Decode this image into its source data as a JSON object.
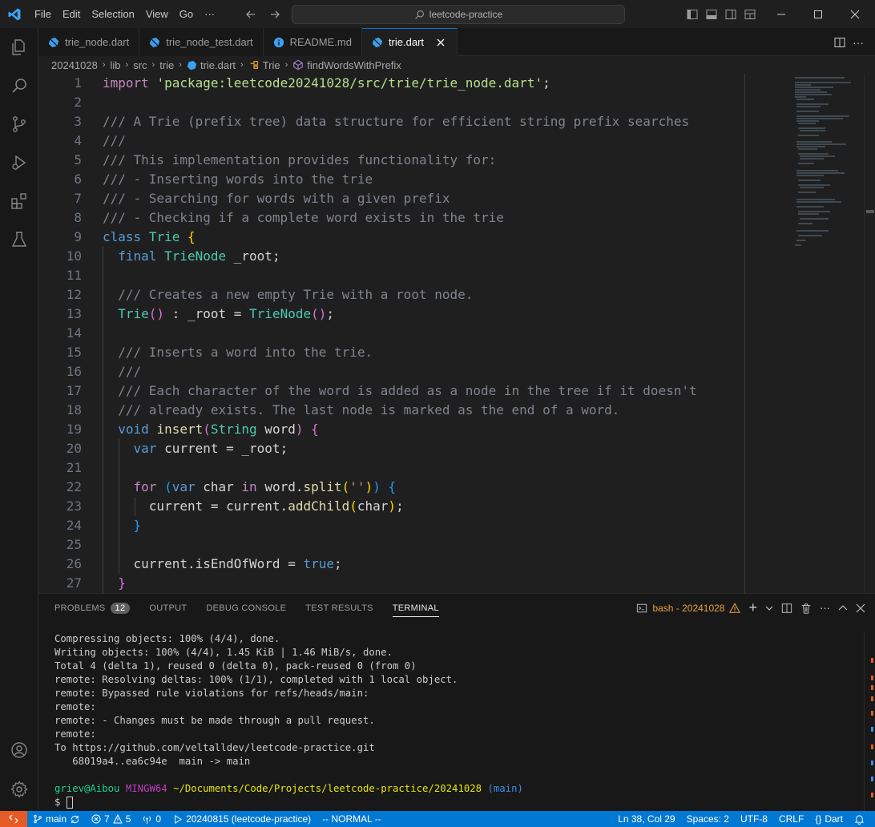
{
  "titlebar": {
    "menu": [
      "File",
      "Edit",
      "Selection",
      "View",
      "Go",
      "···"
    ],
    "search_text": "leetcode-practice"
  },
  "tabs": [
    {
      "label": "trie_node.dart",
      "icon": "dart-icon",
      "active": false
    },
    {
      "label": "trie_node_test.dart",
      "icon": "dart-icon",
      "active": false
    },
    {
      "label": "README.md",
      "icon": "info-icon",
      "active": false
    },
    {
      "label": "trie.dart",
      "icon": "dart-icon",
      "active": true
    }
  ],
  "breadcrumb": [
    "20241028",
    "lib",
    "src",
    "trie",
    "trie.dart",
    "Trie",
    "findWordsWithPrefix"
  ],
  "editor": {
    "line_numbers": [
      "1",
      "2",
      "3",
      "4",
      "5",
      "6",
      "7",
      "8",
      "9",
      "10",
      "11",
      "12",
      "13",
      "14",
      "15",
      "16",
      "17",
      "18",
      "19",
      "20",
      "21",
      "22",
      "23",
      "24",
      "25",
      "26",
      "27"
    ],
    "import_path": "'package:leetcode20241028/src/trie/trie_node.dart'",
    "comments": {
      "l3": "/// A Trie (prefix tree) data structure for efficient string prefix searches",
      "l4": "///",
      "l5": "/// This implementation provides functionality for:",
      "l6": "/// - Inserting words into the trie",
      "l7": "/// - Searching for words with a given prefix",
      "l8": "/// - Checking if a complete word exists in the trie",
      "l12": "/// Creates a new empty Trie with a root node.",
      "l15": "/// Inserts a word into the trie.",
      "l16": "///",
      "l17": "/// Each character of the word is added as a node in the tree if it doesn't",
      "l18": "/// already exists. The last node is marked as the end of a word."
    },
    "split_arg": "''"
  },
  "panel": {
    "tabs": [
      "PROBLEMS",
      "OUTPUT",
      "DEBUG CONSOLE",
      "TEST RESULTS",
      "TERMINAL"
    ],
    "problems_count": "12",
    "terminal_name": "bash - 20241028",
    "terminal_lines": [
      "Compressing objects: 100% (4/4), done.",
      "Writing objects: 100% (4/4), 1.45 KiB | 1.46 MiB/s, done.",
      "Total 4 (delta 1), reused 0 (delta 0), pack-reused 0 (from 0)",
      "remote: Resolving deltas: 100% (1/1), completed with 1 local object.",
      "remote: Bypassed rule violations for refs/heads/main:",
      "remote:",
      "remote: - Changes must be made through a pull request.",
      "remote:",
      "To https://github.com/veltalldev/leetcode-practice.git",
      "   68019a4..ea6c94e  main -> main"
    ],
    "prompt": {
      "user": "griev@Aibou",
      "host": "MINGW64",
      "path": "~/Documents/Code/Projects/leetcode-practice/20241028",
      "branch": "(main)",
      "symbol": "$"
    }
  },
  "statusbar": {
    "branch": "main",
    "errors": "7",
    "warnings": "5",
    "ports": "0",
    "run_config": "20240815 (leetcode-practice)",
    "vim_mode": "-- NORMAL --",
    "position": "Ln 38, Col 29",
    "spaces": "Spaces: 2",
    "encoding": "UTF-8",
    "eol": "CRLF",
    "language": "Dart"
  },
  "colors": {
    "accent": "#0078d4",
    "remote": "#e55b23",
    "warning": "#e7a23a"
  }
}
